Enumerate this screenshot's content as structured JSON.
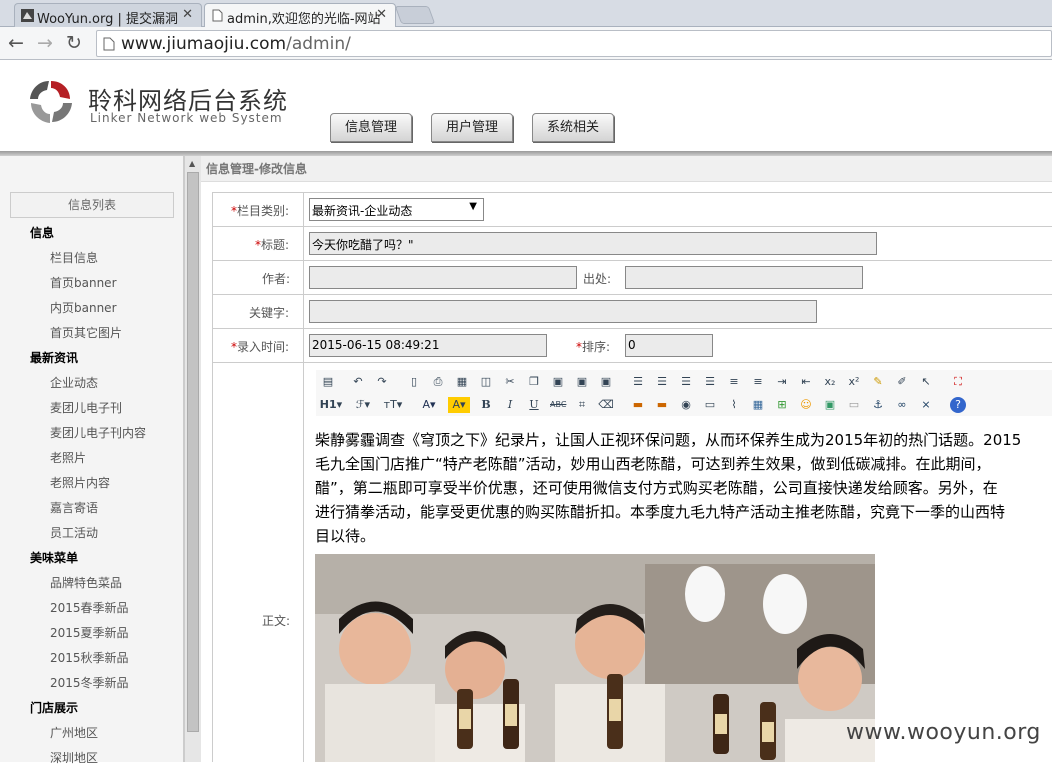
{
  "browser": {
    "tabs": [
      {
        "title": "WooYun.org | 提交漏洞"
      },
      {
        "title": "admin,欢迎您的光临-网站"
      }
    ],
    "url_host": "www.jiumaojiu.com",
    "url_path": "/admin/"
  },
  "header": {
    "brand_cn": "聆科网络后台系统",
    "brand_en": "Linker Network web System",
    "nav": [
      "信息管理",
      "用户管理",
      "系统相关"
    ]
  },
  "sidebar": {
    "heading": "信息列表",
    "groups": [
      {
        "title": "信息",
        "items": [
          "栏目信息",
          "首页banner",
          "内页banner",
          "首页其它图片"
        ]
      },
      {
        "title": "最新资讯",
        "items": [
          "企业动态",
          "麦团儿电子刊",
          "麦团儿电子刊内容",
          "老照片",
          "老照片内容",
          "嘉言寄语",
          "员工活动"
        ]
      },
      {
        "title": "美味菜单",
        "items": [
          "品牌特色菜品",
          "2015春季新品",
          "2015夏季新品",
          "2015秋季新品",
          "2015冬季新品"
        ]
      },
      {
        "title": "门店展示",
        "items": [
          "广州地区",
          "深圳地区"
        ]
      }
    ]
  },
  "form": {
    "page_title": "信息管理-修改信息",
    "category_label": "栏目类别:",
    "category_value": "最新资讯-企业动态",
    "title_label": "标题:",
    "title_value": "今天你吃醋了吗？\"",
    "author_label": "作者:",
    "author_value": "",
    "source_label": "出处:",
    "source_value": "",
    "keywords_label": "关键字:",
    "keywords_value": "",
    "time_label": "录入时间:",
    "time_value": "2015-06-15 08:49:21",
    "order_label": "排序:",
    "order_value": "0",
    "body_label": "正文:",
    "required_mark": "*"
  },
  "editor": {
    "paragraph_lines": [
      "柴静雾霾调查《穹顶之下》纪录片，让国人正视环保问题，从而环保养生成为2015年初的热门话题。2015",
      "毛九全国门店推广“特产老陈醋”活动，妙用山西老陈醋，可达到养生效果，做到低碳减排。在此期间，",
      "醋”，第二瓶即可享受半价优惠，还可使用微信支付方式购买老陈醋，公司直接快递发给顾客。另外，在",
      "进行猜拳活动，能享受更优惠的购买陈醋折扣。本季度九毛九特产活动主推老陈醋，究竟下一季的山西特",
      "目以待。"
    ]
  },
  "watermark": "www.wooyun.org"
}
